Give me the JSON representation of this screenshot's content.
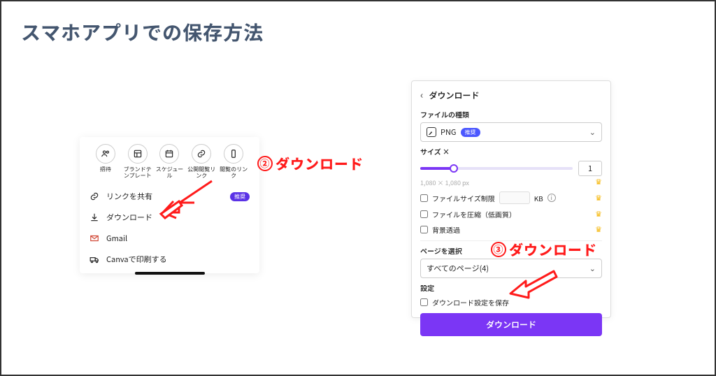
{
  "title": "スマホアプリでの保存方法",
  "share_panel": {
    "row": [
      {
        "label": "招待"
      },
      {
        "label": "ブランドテンプレート"
      },
      {
        "label": "スケジュール"
      },
      {
        "label": "公開閲覧リンク"
      },
      {
        "label": "閲覧のリンク"
      }
    ],
    "menu": {
      "share_link": "リンクを共有",
      "recommend_badge": "推奨",
      "download": "ダウンロード",
      "gmail": "Gmail",
      "print": "Canvaで印刷する"
    }
  },
  "download_panel": {
    "title": "ダウンロード",
    "file_type_label": "ファイルの種類",
    "file_type_value": "PNG",
    "file_type_badge": "推奨",
    "size_label": "サイズ ×",
    "size_value": "1",
    "dimensions": "1,080 × 1,080 px",
    "opt_filesize": "ファイルサイズ制限",
    "kb_unit": "KB",
    "opt_compress": "ファイルを圧縮（低画質）",
    "opt_transparent": "背景透過",
    "pages_label": "ページを選択",
    "pages_value": "すべてのページ(4)",
    "settings_label": "設定",
    "opt_save_settings": "ダウンロード設定を保存",
    "button": "ダウンロード"
  },
  "callouts": {
    "c2_num": "②",
    "c2_text": "ダウンロード",
    "c3_num": "③",
    "c3_text": "ダウンロード"
  },
  "colors": {
    "accent": "#7b36f5",
    "callout": "#ff1b1b"
  }
}
